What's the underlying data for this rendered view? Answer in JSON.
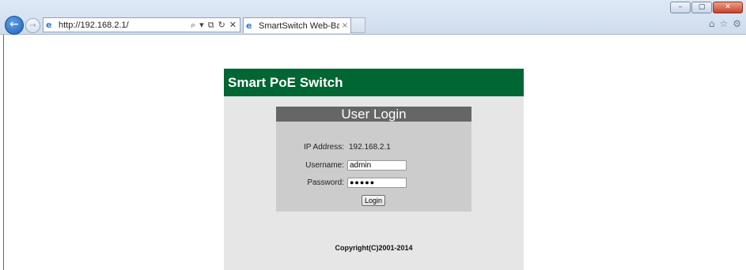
{
  "browser": {
    "address_url": "http://192.168.2.1/",
    "tab_title": "SmartSwitch Web-Base ...",
    "tab_close": "×",
    "address_tools": {
      "search": "⌕",
      "dropdown": "▾",
      "compat": "⧉",
      "refresh": "↻",
      "stop": "✕"
    },
    "window_controls": {
      "minimize": "–",
      "maximize": "▢",
      "close": "✕"
    },
    "right_tools": {
      "home": "⌂",
      "favorites": "☆",
      "settings": "⚙"
    },
    "nav": {
      "back": "←",
      "forward": "→"
    },
    "icons": [
      "back-icon",
      "forward-icon",
      "ie-page-icon",
      "search-icon",
      "refresh-icon",
      "stop-icon",
      "home-icon",
      "star-icon",
      "gear-icon"
    ]
  },
  "page": {
    "app_title": "Smart PoE Switch",
    "login_title": "User Login",
    "ip_label": "IP Address:",
    "ip_value": "192.168.2.1",
    "username_label": "Username:",
    "username_value": "admin",
    "password_label": "Password:",
    "password_value": "●●●●●",
    "login_button": "Login",
    "copyright": "Copyright(C)2001-2014"
  },
  "colors": {
    "header_green": "#006633",
    "login_title_bg": "#666666",
    "login_box_bg": "#cccccc",
    "panel_bg": "#e6e6e6"
  }
}
